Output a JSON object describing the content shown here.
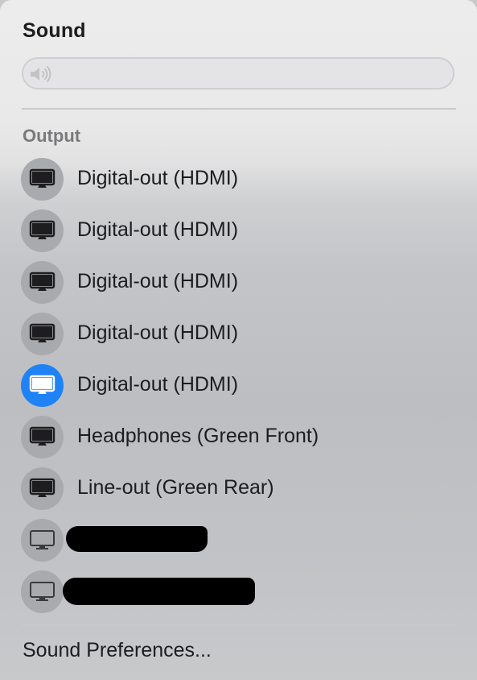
{
  "menu": {
    "title": "Sound",
    "volume": {
      "icon": "speaker-icon",
      "level": 0
    },
    "output_section_label": "Output",
    "devices": [
      {
        "label": "Digital-out (HDMI)",
        "icon": "display-icon",
        "selected": false
      },
      {
        "label": "Digital-out (HDMI)",
        "icon": "display-icon",
        "selected": false
      },
      {
        "label": "Digital-out (HDMI)",
        "icon": "display-icon",
        "selected": false
      },
      {
        "label": "Digital-out (HDMI)",
        "icon": "display-icon",
        "selected": false
      },
      {
        "label": "Digital-out (HDMI)",
        "icon": "display-icon",
        "selected": true
      },
      {
        "label": "Headphones (Green Front)",
        "icon": "display-icon",
        "selected": false
      },
      {
        "label": "Line-out (Green Rear)",
        "icon": "display-icon",
        "selected": false
      },
      {
        "label": "",
        "icon": "display-icon",
        "selected": false,
        "redacted": true
      },
      {
        "label": "",
        "icon": "display-icon",
        "selected": false,
        "redacted": true
      }
    ],
    "footer_link": "Sound Preferences..."
  },
  "colors": {
    "accent": "#1f82f6",
    "icon_bg": "#a9aaad",
    "text": "#1d1d1f",
    "section_label": "#7a7a7c"
  }
}
